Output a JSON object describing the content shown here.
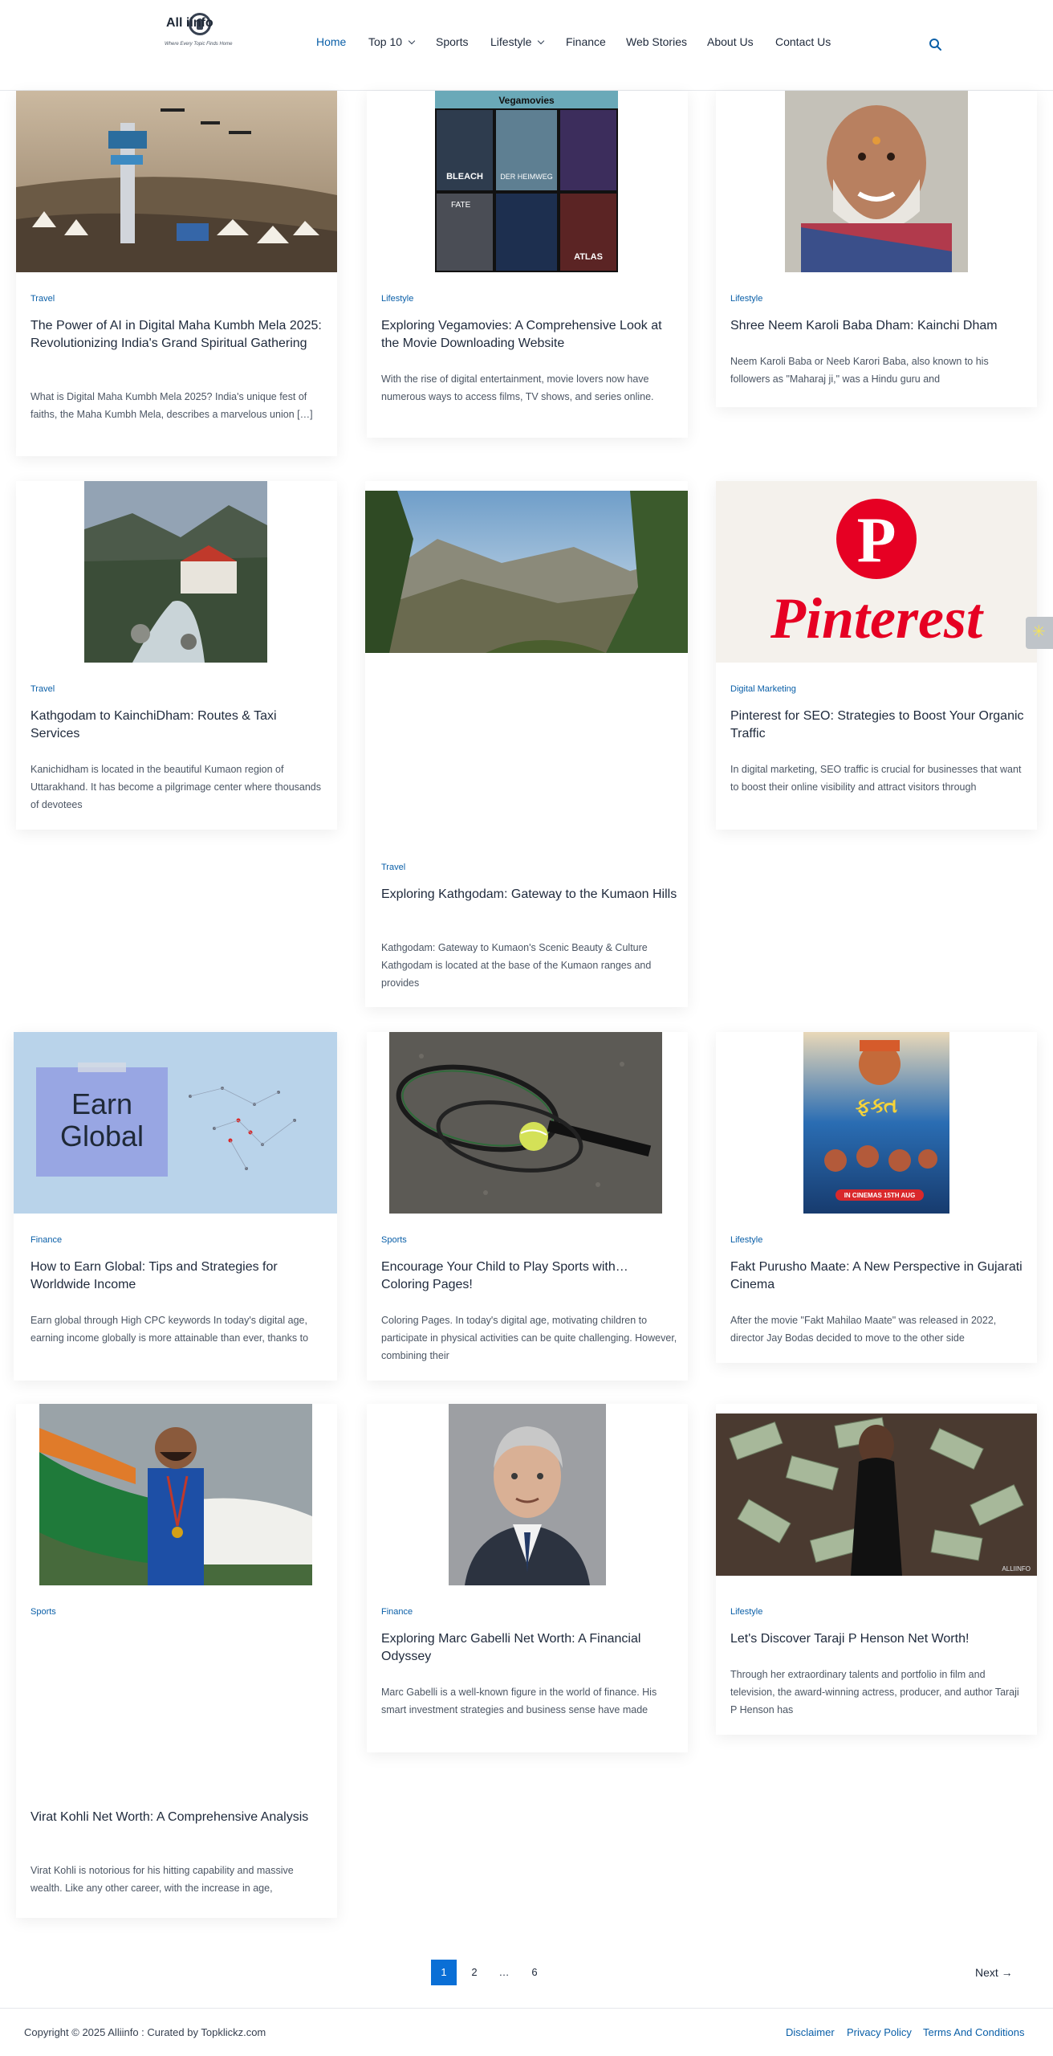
{
  "site": {
    "logo_text": "All  iinfo",
    "tagline": "Where Every Topic Finds Home"
  },
  "nav": [
    {
      "label": "Home",
      "active": true,
      "has_dropdown": false
    },
    {
      "label": "Top 10",
      "active": false,
      "has_dropdown": true
    },
    {
      "label": "Sports",
      "active": false,
      "has_dropdown": false
    },
    {
      "label": "Lifestyle",
      "active": false,
      "has_dropdown": true
    },
    {
      "label": "Finance",
      "active": false,
      "has_dropdown": false
    },
    {
      "label": "Web Stories",
      "active": false,
      "has_dropdown": false
    },
    {
      "label": "About Us",
      "active": false,
      "has_dropdown": false
    },
    {
      "label": "Contact Us",
      "active": false,
      "has_dropdown": false
    }
  ],
  "search_icon": "search-icon",
  "posts": [
    {
      "category": "Travel",
      "title": "The Power of AI in Digital Maha Kumbh Mela 2025: Revolutionizing India's Grand Spiritual Gathering",
      "excerpt": "What is Digital Maha Kumbh Mela 2025? India's unique fest of faiths, the Maha Kumbh Mela, describes a marvelous union […]",
      "image": "kumbh-mela-drones"
    },
    {
      "category": "Lifestyle",
      "title": "Exploring Vegamovies: A Comprehensive Look at the Movie Downloading Website",
      "excerpt": "With the rise of digital entertainment, movie lovers now have numerous ways to access films, TV shows, and series online.",
      "image": "vegamovies-posters",
      "image_caption": "Vegamovies",
      "poster_labels": [
        "BLEACH",
        "DER HEIMWEG",
        "FATE",
        "ATLAS"
      ]
    },
    {
      "category": "Lifestyle",
      "title": "Shree Neem Karoli Baba Dham: Kainchi Dham",
      "excerpt": "Neem Karoli Baba or Neeb Karori Baba, also known to his followers as \"Maharaj ji,\" was a Hindu guru and",
      "image": "neem-karoli-baba-portrait"
    },
    {
      "category": "Travel",
      "title": "Kathgodam to KainchiDham: Routes & Taxi Services",
      "excerpt": "Kanichidham is located in the beautiful Kumaon region of Uttarakhand. It has become a pilgrimage center where thousands of devotees",
      "image": "kainchi-dham-river"
    },
    {
      "category": "Travel",
      "title": "Exploring Kathgodam: Gateway to the Kumaon Hills",
      "excerpt": "Kathgodam: Gateway to Kumaon's Scenic Beauty & Culture Kathgodam is located at the base of the Kumaon ranges and provides",
      "image": "kumaon-hills"
    },
    {
      "category": "Digital Marketing",
      "title": "Pinterest for SEO: Strategies to Boost Your Organic Traffic",
      "excerpt": "In digital marketing, SEO traffic is crucial for businesses that want to boost their online visibility and attract visitors through",
      "image": "pinterest-logo",
      "image_text": "Pinterest"
    },
    {
      "category": "Finance",
      "title": "How to Earn Global: Tips and Strategies for Worldwide Income",
      "excerpt": "Earn global through High CPC keywords  In today's digital age, earning income globally is more attainable than ever, thanks to",
      "image": "earn-global-note",
      "image_text": "Earn Global"
    },
    {
      "category": "Sports",
      "title": "Encourage Your Child to Play Sports with… Coloring Pages!",
      "excerpt": "Coloring Pages. In today's digital age, motivating children to participate in physical activities can be quite challenging. However, combining their",
      "image": "tennis-rackets"
    },
    {
      "category": "Lifestyle",
      "title": "Fakt Purusho Maate: A New Perspective in Gujarati Cinema",
      "excerpt": "After the movie \"Fakt Mahilao Maate\" was released in 2022, director Jay Bodas decided to move to the other side",
      "image": "fakt-purusho-maate-poster",
      "image_text": "IN CINEMAS 15TH AUG"
    },
    {
      "category": "Sports",
      "title": "Virat Kohli Net Worth: A Comprehensive Analysis",
      "excerpt": "Virat Kohli is notorious for his hitting capability and massive wealth. Like any other career, with the increase in age,",
      "image": "cricketer-with-flag"
    },
    {
      "category": "Finance",
      "title": "Exploring Marc Gabelli Net Worth: A Financial Odyssey",
      "excerpt": "Marc Gabelli is a well-known figure in the world of finance. His smart investment strategies and business sense have made",
      "image": "marc-gabelli-portrait"
    },
    {
      "category": "Lifestyle",
      "title": "Let's Discover Taraji P Henson Net Worth!",
      "excerpt": "Through her extraordinary talents and portfolio in film and television, the award-winning actress, producer, and author Taraji P Henson has",
      "image": "money-rain",
      "image_watermark": "ALLIINFO"
    }
  ],
  "pagination": {
    "pages": [
      "1",
      "2",
      "…",
      "6"
    ],
    "current": "1",
    "next_label": "Next →"
  },
  "footer": {
    "copyright": "Copyright © 2025 Alliinfo : Curated by Topklickz.com",
    "links": [
      "Disclaimer",
      "Privacy Policy",
      "Terms And Conditions"
    ]
  },
  "colors": {
    "accent": "#0a5fa8",
    "active_page": "#0a6fd6",
    "text": "#1e293b",
    "muted": "#4b5563"
  }
}
